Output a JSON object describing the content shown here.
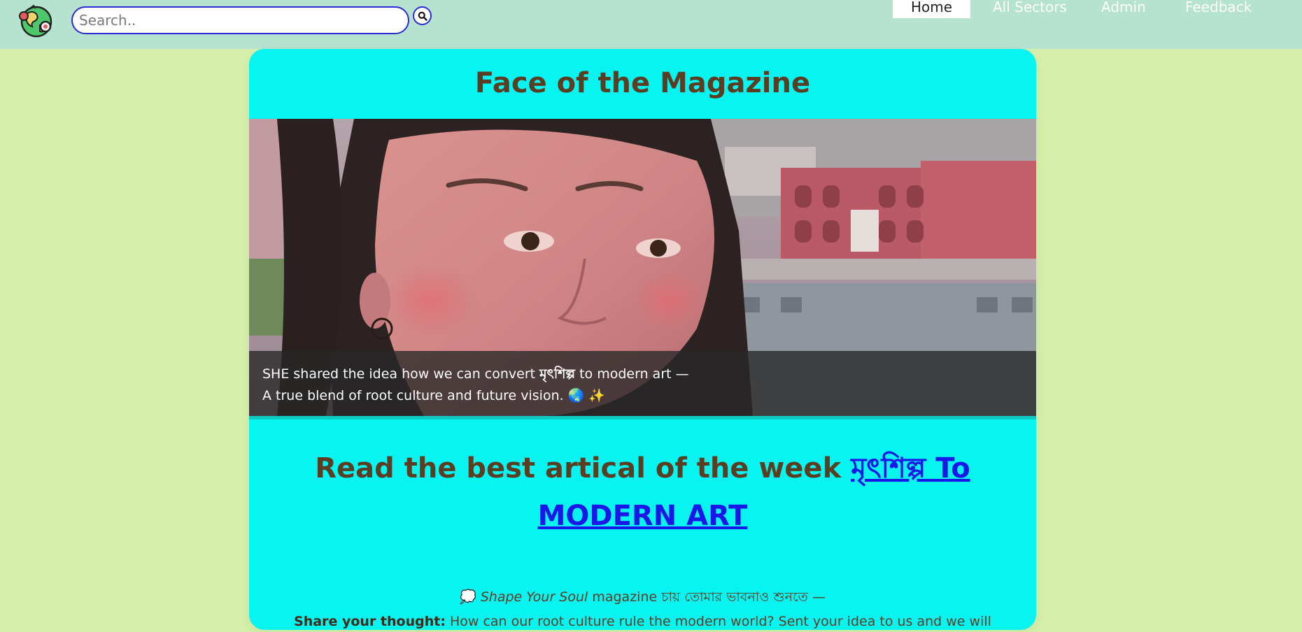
{
  "search": {
    "placeholder": "Search.."
  },
  "nav": {
    "items": [
      {
        "label": "Home",
        "active": true
      },
      {
        "label": "All Sectors",
        "active": false
      },
      {
        "label": "Admin",
        "active": false
      },
      {
        "label": "Feedback",
        "active": false
      }
    ]
  },
  "card": {
    "title": "Face of the Magazine",
    "caption": {
      "line1_prefix": "SHE shared the idea how we can convert ",
      "line1_bold": "মৃৎশিল্প",
      "line1_suffix": " to modern art —",
      "line2": "A true blend of root culture and future vision. 🌏 ✨"
    },
    "feature": {
      "heading": "Read the best artical of the week ",
      "link_text": "মৃৎশিল্প To MODERN ART"
    },
    "tagline": {
      "icon": "💭",
      "italic": "Shape Your Soul",
      "rest": " magazine চায় তোমার ভাবনাও শুনতে —"
    },
    "share": {
      "label": "Share your thought:",
      "text": " How can our root culture rule the modern world? Sent your idea to us and we will select the best one."
    }
  },
  "colors": {
    "page_bg": "#d6efab",
    "topbar_bg": "#b5e3cf",
    "card_bg": "#08f4f1",
    "heading_brown": "#5b3e22",
    "link_blue": "#1a17e8",
    "search_border": "#2b2bd6"
  },
  "icons": {
    "logo": "globe-logo-icon",
    "search": "search-icon"
  }
}
